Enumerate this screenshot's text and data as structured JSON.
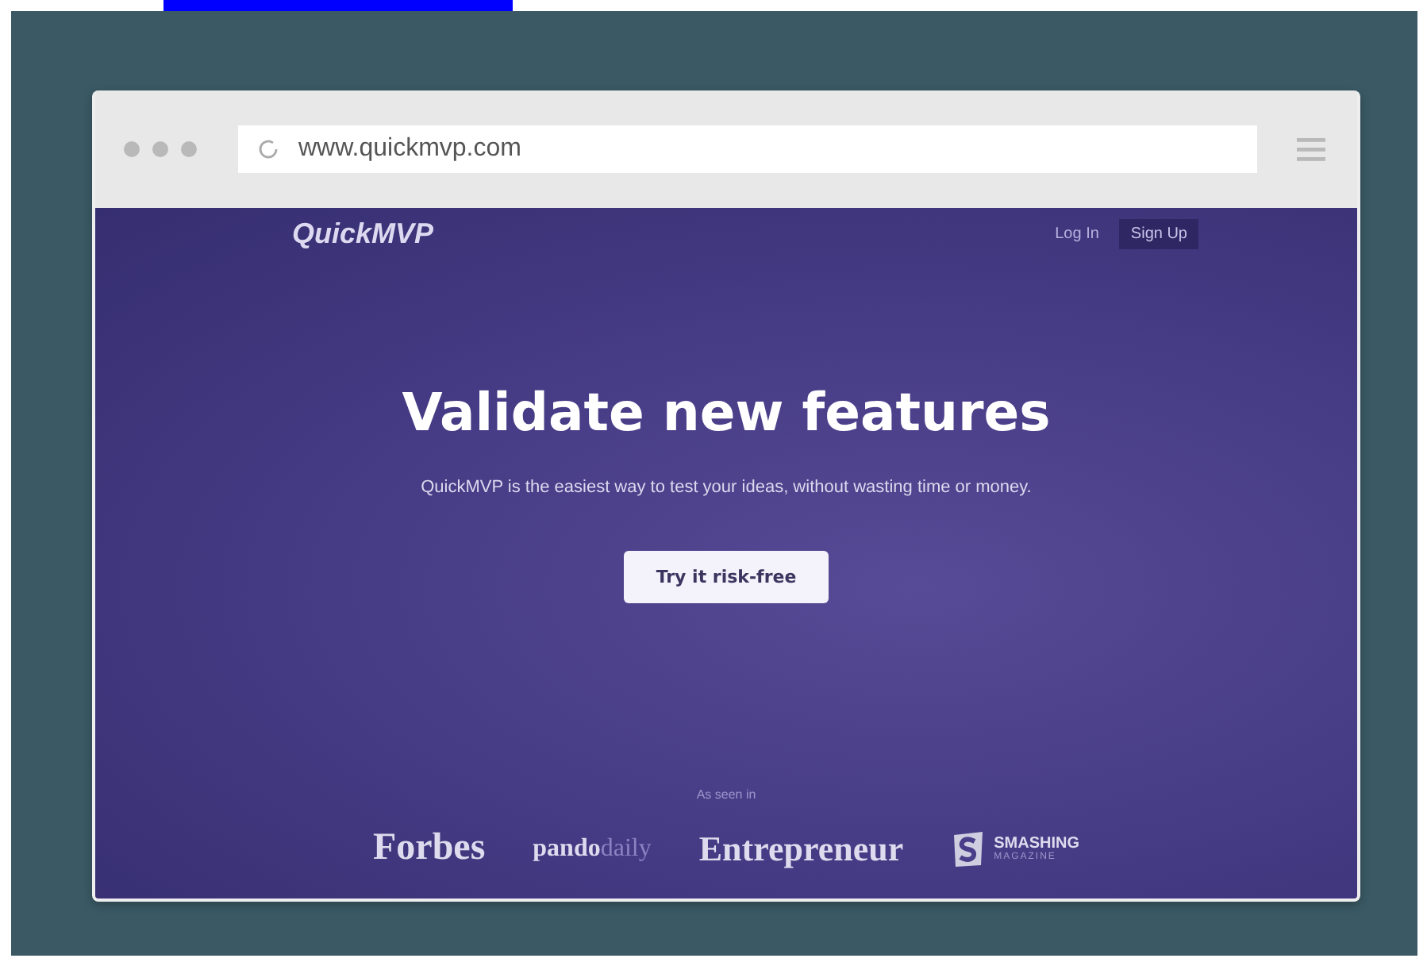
{
  "browser": {
    "url": "www.quickmvp.com"
  },
  "nav": {
    "logo": "QuickMVP",
    "links": [
      {
        "label": "Log In",
        "selected": false
      },
      {
        "label": "Sign Up",
        "selected": true
      }
    ]
  },
  "hero": {
    "title": "Validate new features",
    "subtitle": "QuickMVP is the easiest way to test your ideas, without wasting time or money.",
    "button": "Try it risk-free"
  },
  "press": {
    "caption": "As seen in",
    "logos": [
      {
        "kind": "serif",
        "text": "Forbes"
      },
      {
        "kind": "split",
        "text": "pando",
        "text_2": "daily"
      },
      {
        "kind": "serif",
        "text": "Entrepreneur"
      },
      {
        "kind": "badge",
        "text": "SMASHING",
        "text_2": "MAGAZINE"
      }
    ]
  }
}
